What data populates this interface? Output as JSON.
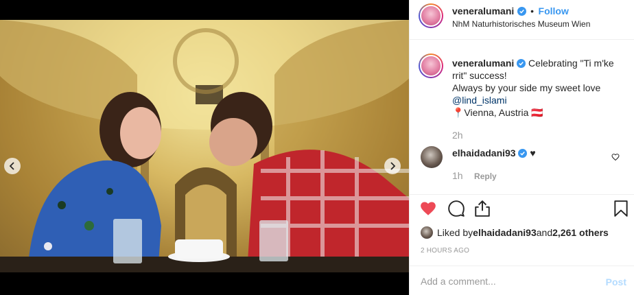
{
  "post": {
    "author": "veneralumani",
    "follow_label": "Follow",
    "dot": "•",
    "location": "NhM Naturhistorisches Museum Wien"
  },
  "caption": {
    "author": "veneralumani",
    "text_line1": " Celebrating \"Ti m'ke rrit\" success!",
    "text_line2": "Always by your side my sweet love",
    "mention": "@lind_islami",
    "text_line3": "📍Vienna, Austria 🇦🇹",
    "time": "2h"
  },
  "comments": [
    {
      "author": "elhaidadani93",
      "text": " ♥",
      "time": "1h",
      "reply_label": "Reply"
    }
  ],
  "likes": {
    "prefix": "Liked by ",
    "user": "elhaidadani93",
    "middle": " and ",
    "count": "2,261 others"
  },
  "timestamp": "2 HOURS AGO",
  "comment_box": {
    "placeholder": "Add a comment...",
    "post_label": "Post"
  },
  "colors": {
    "like_red": "#ed4956",
    "link_blue": "#3897f0",
    "verified_blue": "#3897f0",
    "muted": "#999999"
  },
  "icons": [
    "chevron-left-icon",
    "chevron-right-icon",
    "verified-badge-icon",
    "heart-icon",
    "comment-icon",
    "share-icon",
    "bookmark-icon"
  ]
}
